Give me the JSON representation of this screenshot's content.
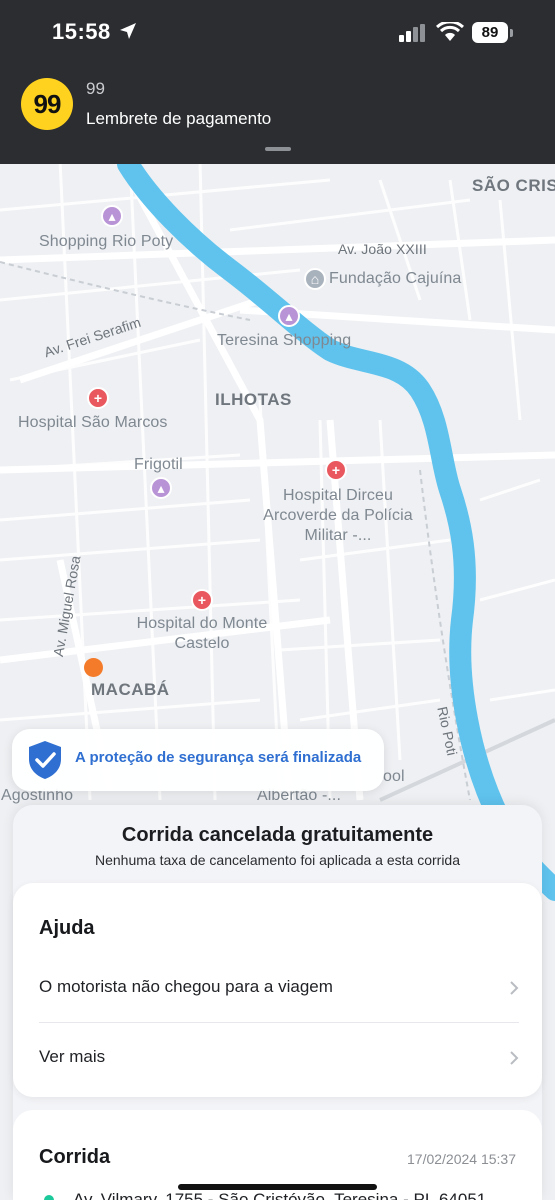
{
  "status_bar": {
    "time": "15:58",
    "battery": "89"
  },
  "notification": {
    "app_icon_text": "99",
    "app_name": "99",
    "title": "Lembrete de pagamento"
  },
  "map": {
    "labels": {
      "sao_cristovao": "SÃO CRIS",
      "shopping_rio_poty": "Shopping Rio Poty",
      "av_joao": "Av. João XXIII",
      "fundacao": "Fundação Cajuína",
      "av_frei": "Av. Frei Serafim",
      "teresina_shopping": "Teresina Shopping",
      "ilhotas": "ILHOTAS",
      "hospital_sao_marcos": "Hospital São Marcos",
      "frigotil": "Frigotil",
      "hospital_dirceu": "Hospital Dirceu Arcoverde da Polícia Militar -...",
      "av_miguel": "Av. Miguel Rosa",
      "hospital_monte": "Hospital do Monte Castelo",
      "macaba": "MACABÁ",
      "rio_poti": "Rio Poti",
      "agostinho": "Agostinho",
      "albertao": "Albertão -...",
      "school": "ool"
    }
  },
  "safety": {
    "text": "A proteção de segurança será finalizada"
  },
  "sheet": {
    "title": "Corrida cancelada gratuitamente",
    "subtitle": "Nenhuma taxa de cancelamento foi aplicada a esta corrida",
    "help": {
      "heading": "Ajuda",
      "items": [
        {
          "label": "O motorista não chegou para a viagem"
        },
        {
          "label": "Ver mais"
        }
      ]
    },
    "ride": {
      "heading": "Corrida",
      "date": "17/02/2024 15:37",
      "address": "Av. Vilmary, 1755 - São Cristóvão, Teresina - PI, 64051"
    }
  },
  "colors": {
    "river": "#5fc3ee",
    "accent_blue": "#2f6fd1",
    "brand_yellow": "#ffd21f",
    "origin_green": "#1cc99a",
    "marker_orange": "#f47b2a"
  }
}
